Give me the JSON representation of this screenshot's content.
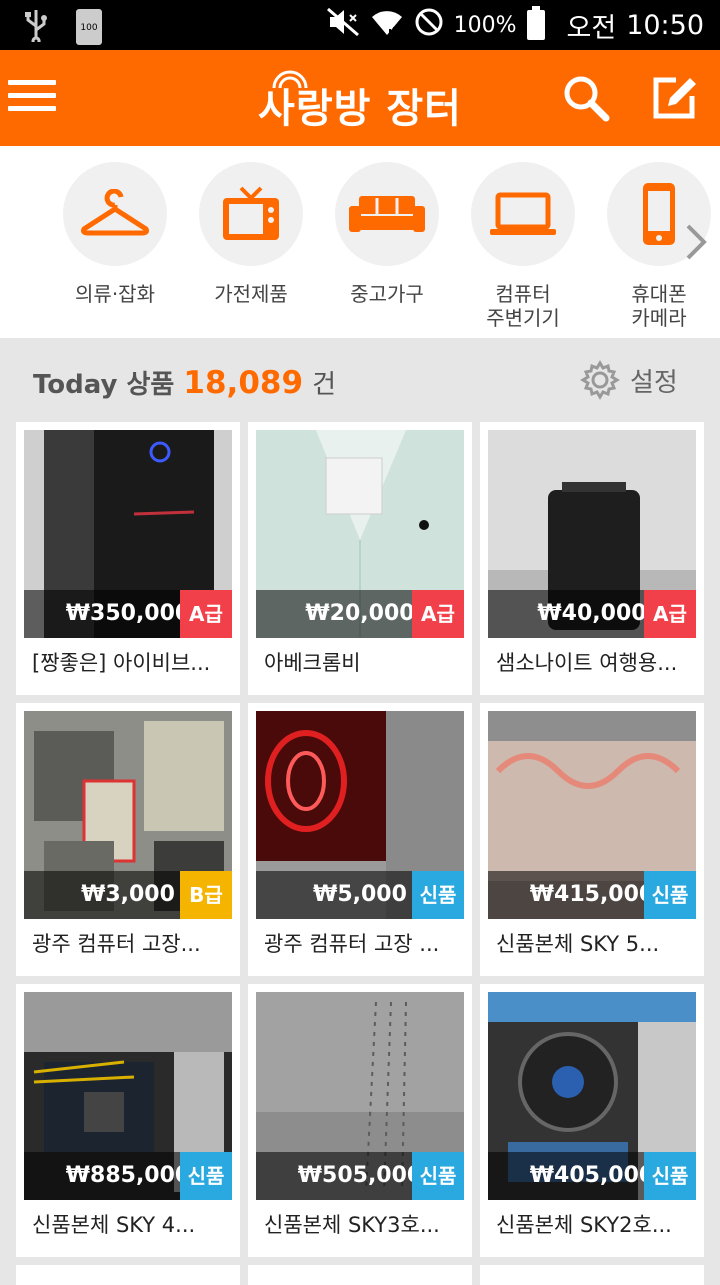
{
  "statusbar": {
    "usb_icon": "usb-icon",
    "battery_small_text": "100",
    "battery_percent": "100%",
    "ampm": "오전",
    "time": "10:50"
  },
  "appbar": {
    "title": "사랑방 장터",
    "brand_color": "#ff6a00"
  },
  "categories": [
    {
      "label": "의류·잡화",
      "icon": "hanger-icon"
    },
    {
      "label": "가전제품",
      "icon": "tv-icon"
    },
    {
      "label": "중고가구",
      "icon": "sofa-icon"
    },
    {
      "label": "컴퓨터\n주변기기",
      "icon": "laptop-icon"
    },
    {
      "label": "휴대폰\n카메라",
      "icon": "phone-icon"
    }
  ],
  "today": {
    "prefix": "Today 상품",
    "count": "18,089",
    "unit": "건",
    "settings_label": "설정"
  },
  "grade_colors": {
    "A급": "#f2404a",
    "B급": "#f5b400",
    "신품": "#29a9e0"
  },
  "products": [
    {
      "price": "₩350,000",
      "grade": "A급",
      "title": "[짱좋은] 아이비브..."
    },
    {
      "price": "₩20,000",
      "grade": "A급",
      "title": "아베크롬비"
    },
    {
      "price": "₩40,000",
      "grade": "A급",
      "title": "샘소나이트 여행용..."
    },
    {
      "price": "₩3,000",
      "grade": "B급",
      "title": "광주 컴퓨터 고장..."
    },
    {
      "price": "₩5,000",
      "grade": "신품",
      "title": "광주 컴퓨터 고장 ..."
    },
    {
      "price": "₩415,000",
      "grade": "신품",
      "title": "신품본체 SKY 5..."
    },
    {
      "price": "₩885,000",
      "grade": "신품",
      "title": "신품본체 SKY 4..."
    },
    {
      "price": "₩505,000",
      "grade": "신품",
      "title": "신품본체 SKY3호..."
    },
    {
      "price": "₩405,000",
      "grade": "신품",
      "title": "신품본체 SKY2호..."
    }
  ]
}
